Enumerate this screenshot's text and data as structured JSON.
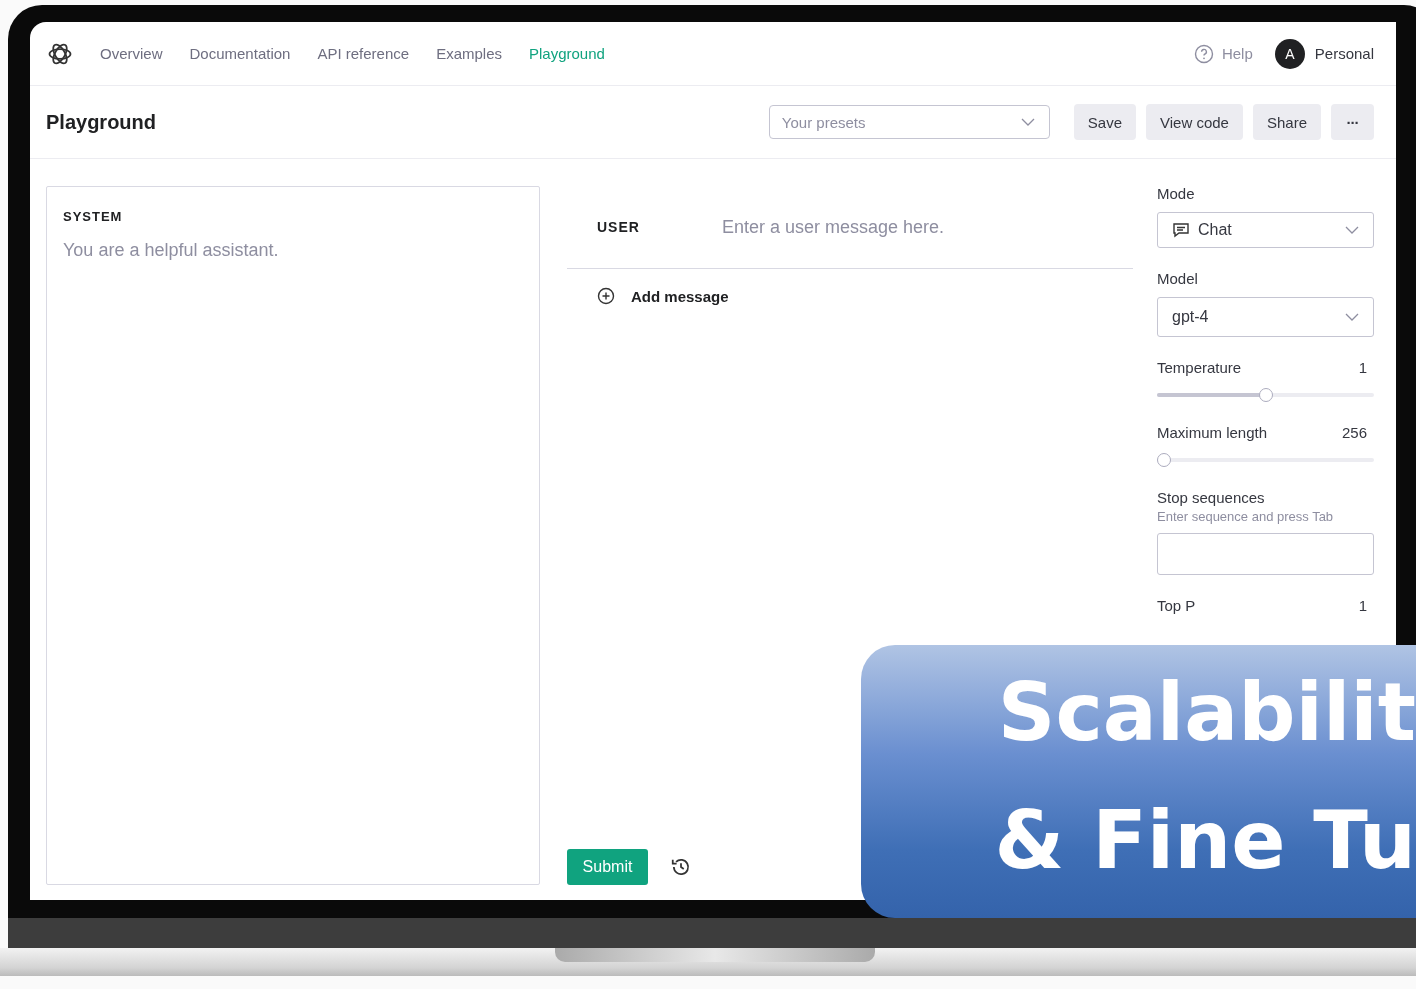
{
  "nav": {
    "links": [
      {
        "label": "Overview",
        "selected": false
      },
      {
        "label": "Documentation",
        "selected": false
      },
      {
        "label": "API reference",
        "selected": false
      },
      {
        "label": "Examples",
        "selected": false
      },
      {
        "label": "Playground",
        "selected": true
      }
    ],
    "help": "Help",
    "avatar": "A",
    "account": "Personal"
  },
  "header": {
    "title": "Playground",
    "presets": {
      "placeholder": "Your presets"
    },
    "buttons": [
      "Save",
      "View code",
      "Share"
    ],
    "more": "···"
  },
  "system": {
    "label": "SYSTEM",
    "placeholder": "You are a helpful assistant."
  },
  "messages": [
    {
      "role": "USER",
      "placeholder": "Enter a user message here."
    }
  ],
  "add_message": "Add message",
  "submit": "Submit",
  "settings": [
    {
      "kind": "select",
      "label": "Mode",
      "value": "Chat"
    },
    {
      "kind": "select",
      "label": "Model",
      "value": "gpt-4"
    },
    {
      "kind": "slider",
      "label": "Temperature",
      "reading": "1",
      "level": 0.5
    },
    {
      "kind": "slider",
      "label": "Maximum length",
      "reading": "256",
      "level": 0
    },
    {
      "kind": "input",
      "label": "Stop sequences",
      "hint": "Enter sequence and press Tab"
    },
    {
      "kind": "value",
      "label": "Top P",
      "reading": "1"
    }
  ],
  "banner": {
    "lines": [
      "Scalabilit",
      "& Fine Tu"
    ]
  }
}
